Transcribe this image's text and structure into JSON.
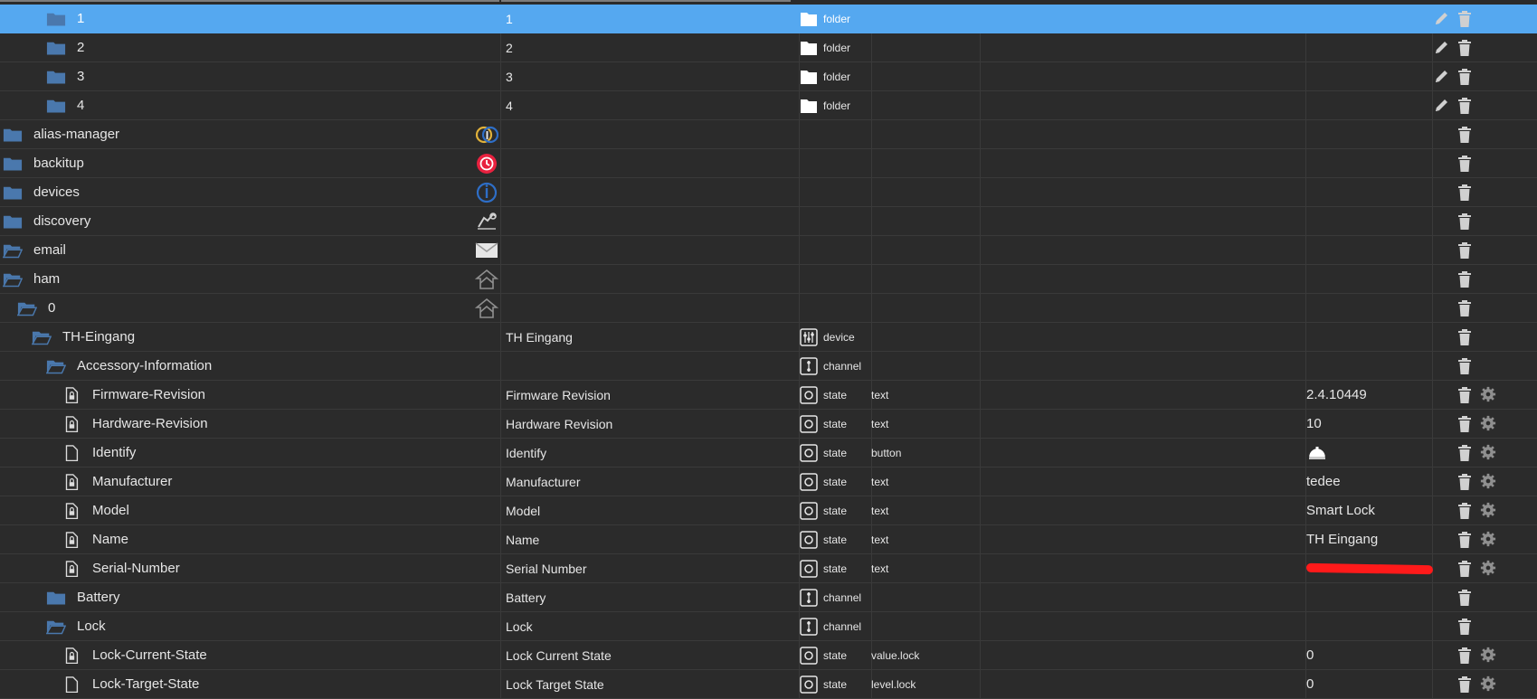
{
  "rows": [
    {
      "label": "1",
      "name": "1",
      "type": "folder",
      "role": "",
      "value": "",
      "level": 5,
      "icon": "folder-closed",
      "adapter": "",
      "actions": "edit-delete",
      "selected": true
    },
    {
      "label": "2",
      "name": "2",
      "type": "folder",
      "role": "",
      "value": "",
      "level": 5,
      "icon": "folder-closed",
      "adapter": "",
      "actions": "edit-delete"
    },
    {
      "label": "3",
      "name": "3",
      "type": "folder",
      "role": "",
      "value": "",
      "level": 5,
      "icon": "folder-closed",
      "adapter": "",
      "actions": "edit-delete"
    },
    {
      "label": "4",
      "name": "4",
      "type": "folder",
      "role": "",
      "value": "",
      "level": 5,
      "icon": "folder-closed",
      "adapter": "",
      "actions": "edit-delete"
    },
    {
      "label": "alias-manager",
      "name": "",
      "type": "",
      "role": "",
      "value": "",
      "level": 0,
      "icon": "folder-closed",
      "adapter": "alias",
      "actions": "delete"
    },
    {
      "label": "backitup",
      "name": "",
      "type": "",
      "role": "",
      "value": "",
      "level": 0,
      "icon": "folder-closed",
      "adapter": "backitup",
      "actions": "delete"
    },
    {
      "label": "devices",
      "name": "",
      "type": "",
      "role": "",
      "value": "",
      "level": 0,
      "icon": "folder-closed",
      "adapter": "devices",
      "actions": "delete"
    },
    {
      "label": "discovery",
      "name": "",
      "type": "",
      "role": "",
      "value": "",
      "level": 0,
      "icon": "folder-closed",
      "adapter": "discovery",
      "actions": "delete"
    },
    {
      "label": "email",
      "name": "",
      "type": "",
      "role": "",
      "value": "",
      "level": 0,
      "icon": "folder-open",
      "adapter": "email",
      "actions": "delete"
    },
    {
      "label": "ham",
      "name": "",
      "type": "",
      "role": "",
      "value": "",
      "level": 0,
      "icon": "folder-open",
      "adapter": "ham",
      "actions": "delete"
    },
    {
      "label": "0",
      "name": "",
      "type": "",
      "role": "",
      "value": "",
      "level": 1,
      "icon": "folder-open",
      "adapter": "ham",
      "actions": "delete"
    },
    {
      "label": "TH-Eingang",
      "name": "TH Eingang",
      "type": "device",
      "role": "",
      "value": "",
      "level": 2,
      "icon": "folder-open",
      "adapter": "",
      "actions": "delete"
    },
    {
      "label": "Accessory-Information",
      "name": "",
      "type": "channel",
      "role": "",
      "value": "",
      "level": 3,
      "icon": "folder-open",
      "adapter": "",
      "actions": "delete"
    },
    {
      "label": "Firmware-Revision",
      "name": "Firmware Revision",
      "type": "state",
      "role": "text",
      "value": "2.4.10449",
      "level": 4,
      "icon": "file-lock",
      "adapter": "",
      "actions": "delete-gear"
    },
    {
      "label": "Hardware-Revision",
      "name": "Hardware Revision",
      "type": "state",
      "role": "text",
      "value": "10",
      "level": 4,
      "icon": "file-lock",
      "adapter": "",
      "actions": "delete-gear"
    },
    {
      "label": "Identify",
      "name": "Identify",
      "type": "state",
      "role": "button",
      "value": "",
      "level": 4,
      "icon": "file",
      "adapter": "",
      "actions": "delete-gear",
      "valueIcon": "bell"
    },
    {
      "label": "Manufacturer",
      "name": "Manufacturer",
      "type": "state",
      "role": "text",
      "value": "tedee",
      "level": 4,
      "icon": "file-lock",
      "adapter": "",
      "actions": "delete-gear"
    },
    {
      "label": "Model",
      "name": "Model",
      "type": "state",
      "role": "text",
      "value": "Smart Lock",
      "level": 4,
      "icon": "file-lock",
      "adapter": "",
      "actions": "delete-gear"
    },
    {
      "label": "Name",
      "name": "Name",
      "type": "state",
      "role": "text",
      "value": "TH Eingang",
      "level": 4,
      "icon": "file-lock",
      "adapter": "",
      "actions": "delete-gear"
    },
    {
      "label": "Serial-Number",
      "name": "Serial Number",
      "type": "state",
      "role": "text",
      "value": "",
      "level": 4,
      "icon": "file-lock",
      "adapter": "",
      "actions": "delete-gear",
      "redacted": true
    },
    {
      "label": "Battery",
      "name": "Battery",
      "type": "channel",
      "role": "",
      "value": "",
      "level": 3,
      "icon": "folder-closed",
      "adapter": "",
      "actions": "delete"
    },
    {
      "label": "Lock",
      "name": "Lock",
      "type": "channel",
      "role": "",
      "value": "",
      "level": 3,
      "icon": "folder-open",
      "adapter": "",
      "actions": "delete"
    },
    {
      "label": "Lock-Current-State",
      "name": "Lock Current State",
      "type": "state",
      "role": "value.lock",
      "value": "0",
      "level": 4,
      "icon": "file-lock",
      "adapter": "",
      "actions": "delete-gear"
    },
    {
      "label": "Lock-Target-State",
      "name": "Lock Target State",
      "type": "state",
      "role": "level.lock",
      "value": "0",
      "level": 4,
      "icon": "file",
      "adapter": "",
      "actions": "delete-gear"
    }
  ],
  "colors": {
    "background": "#2b2b2b",
    "selected": "#55a8f0",
    "folder": "#4a78ad",
    "text": "#e6e6e6",
    "icon": "#cfcfcf",
    "redact": "#ff1a1a"
  }
}
